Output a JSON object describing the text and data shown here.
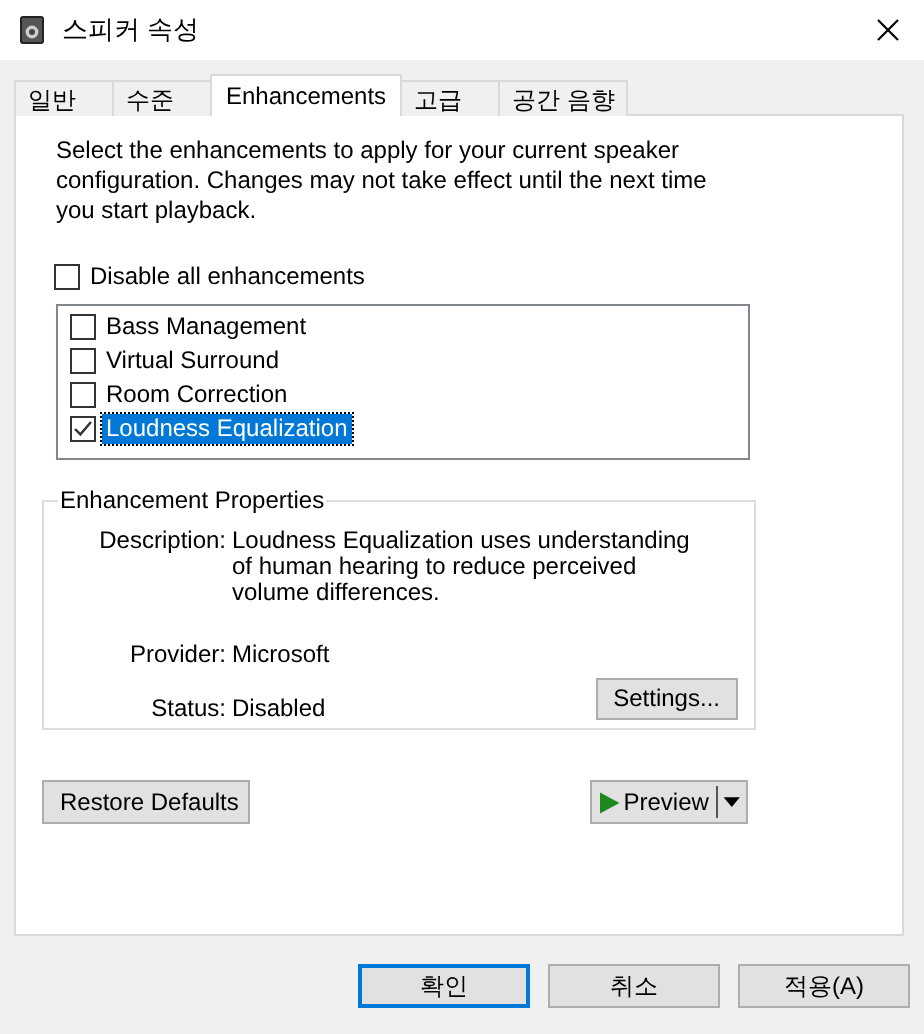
{
  "window": {
    "title": "스피커 속성"
  },
  "tabs": [
    {
      "label": "일반",
      "selected": false
    },
    {
      "label": "수준",
      "selected": false
    },
    {
      "label": "Enhancements",
      "selected": true
    },
    {
      "label": "고급",
      "selected": false
    },
    {
      "label": "공간 음향",
      "selected": false
    }
  ],
  "intro": "Select the enhancements to apply for your current speaker configuration. Changes may not take effect until the next time you start playback.",
  "disable_all": {
    "label": "Disable all enhancements",
    "checked": false
  },
  "enhancements": [
    {
      "label": "Bass Management",
      "checked": false,
      "selected": false
    },
    {
      "label": "Virtual Surround",
      "checked": false,
      "selected": false
    },
    {
      "label": "Room Correction",
      "checked": false,
      "selected": false
    },
    {
      "label": "Loudness Equalization",
      "checked": true,
      "selected": true
    }
  ],
  "properties": {
    "title": "Enhancement Properties",
    "fields": [
      {
        "label": "Description:",
        "value": "Loudness Equalization uses understanding of human hearing to reduce perceived volume differences."
      },
      {
        "label": "Provider:",
        "value": "Microsoft"
      },
      {
        "label": "Status:",
        "value": "Disabled"
      }
    ],
    "settings_button": "Settings..."
  },
  "restore_button": "Restore Defaults",
  "preview_button": "Preview",
  "buttons": [
    {
      "label": "확인",
      "default": true
    },
    {
      "label": "취소",
      "default": false
    },
    {
      "label": "적용(A)",
      "default": false
    }
  ]
}
